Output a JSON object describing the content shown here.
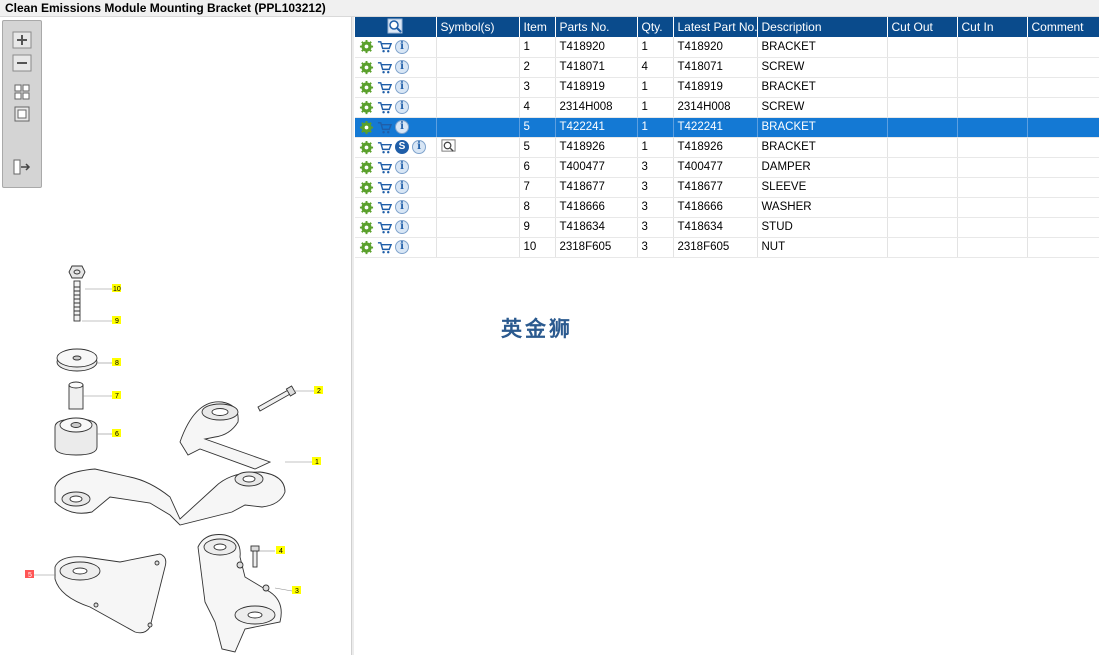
{
  "window": {
    "title": "Clean Emissions Module Mounting Bracket (PPL103212)"
  },
  "toolbar": {
    "buttons": [
      {
        "name": "zoom-in-button",
        "icon": "zoom-in-icon"
      },
      {
        "name": "zoom-out-button",
        "icon": "zoom-out-icon"
      },
      {
        "name": "fit-all-button",
        "icon": "fit-all-icon"
      },
      {
        "name": "actual-size-button",
        "icon": "actual-size-icon"
      },
      {
        "name": "export-button",
        "icon": "export-icon"
      }
    ]
  },
  "diagram": {
    "callouts": [
      "10",
      "9",
      "8",
      "7",
      "6",
      "2",
      "1",
      "4",
      "3",
      "5"
    ],
    "highlight_color": "#ffff00",
    "selected_callout_color": "#ff5555"
  },
  "table": {
    "columns": [
      "",
      "Symbol(s)",
      "Item",
      "Parts No.",
      "Qty.",
      "Latest Part No.",
      "Description",
      "Cut Out",
      "Cut In",
      "Comment"
    ],
    "rows": [
      {
        "item": "1",
        "part_no": "T418920",
        "qty": "1",
        "latest": "T418920",
        "desc": "BRACKET",
        "selected": false,
        "extra": false
      },
      {
        "item": "2",
        "part_no": "T418071",
        "qty": "4",
        "latest": "T418071",
        "desc": "SCREW",
        "selected": false,
        "extra": false
      },
      {
        "item": "3",
        "part_no": "T418919",
        "qty": "1",
        "latest": "T418919",
        "desc": "BRACKET",
        "selected": false,
        "extra": false
      },
      {
        "item": "4",
        "part_no": "2314H008",
        "qty": "1",
        "latest": "2314H008",
        "desc": "SCREW",
        "selected": false,
        "extra": false
      },
      {
        "item": "5",
        "part_no": "T422241",
        "qty": "1",
        "latest": "T422241",
        "desc": "BRACKET",
        "selected": true,
        "extra": false
      },
      {
        "item": "5",
        "part_no": "T418926",
        "qty": "1",
        "latest": "T418926",
        "desc": "BRACKET",
        "selected": false,
        "extra": true
      },
      {
        "item": "6",
        "part_no": "T400477",
        "qty": "3",
        "latest": "T400477",
        "desc": "DAMPER",
        "selected": false,
        "extra": false
      },
      {
        "item": "7",
        "part_no": "T418677",
        "qty": "3",
        "latest": "T418677",
        "desc": "SLEEVE",
        "selected": false,
        "extra": false
      },
      {
        "item": "8",
        "part_no": "T418666",
        "qty": "3",
        "latest": "T418666",
        "desc": "WASHER",
        "selected": false,
        "extra": false
      },
      {
        "item": "9",
        "part_no": "T418634",
        "qty": "3",
        "latest": "T418634",
        "desc": "STUD",
        "selected": false,
        "extra": false
      },
      {
        "item": "10",
        "part_no": "2318F605",
        "qty": "3",
        "latest": "2318F605",
        "desc": "NUT",
        "selected": false,
        "extra": false
      }
    ]
  },
  "watermark": "英金狮",
  "colors": {
    "header_bg": "#0a4b8c",
    "selected_row": "#1479d4",
    "gear": "#5aa02c",
    "cart": "#1f5ea8"
  }
}
